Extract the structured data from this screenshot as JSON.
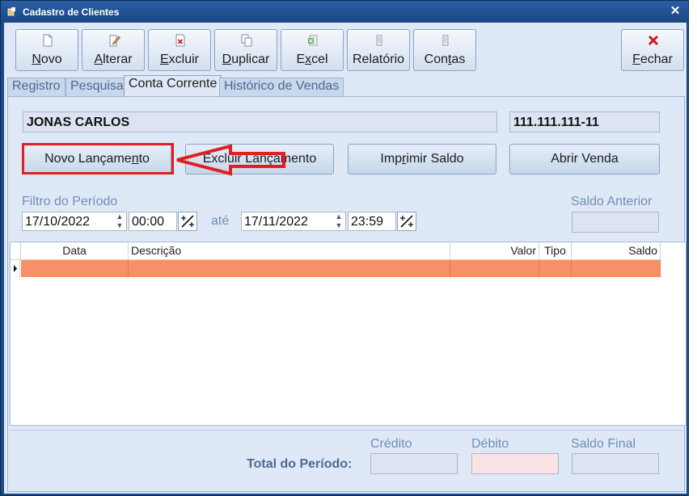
{
  "window": {
    "title": "Cadastro de Clientes",
    "close_symbol": "✕"
  },
  "toolbar": {
    "buttons": [
      {
        "label_pre": "",
        "label_u": "N",
        "label_post": "ovo",
        "icon": "new-document-icon"
      },
      {
        "label_pre": "",
        "label_u": "A",
        "label_post": "lterar",
        "icon": "edit-pencil-icon"
      },
      {
        "label_pre": "",
        "label_u": "E",
        "label_post": "xcluir",
        "icon": "delete-document-icon"
      },
      {
        "label_pre": "",
        "label_u": "D",
        "label_post": "uplicar",
        "icon": "duplicate-icon"
      },
      {
        "label_pre": "E",
        "label_u": "x",
        "label_post": "cel",
        "icon": "excel-icon"
      },
      {
        "label_pre": "Relatório",
        "label_u": "",
        "label_post": "",
        "icon": "report-icon"
      },
      {
        "label_pre": "Con",
        "label_u": "t",
        "label_post": "as",
        "icon": "accounts-icon"
      }
    ],
    "close_button": {
      "label_pre": "",
      "label_u": "F",
      "label_post": "echar",
      "icon": "red-x-icon"
    }
  },
  "tabs": [
    "Registro",
    "Pesquisa",
    "Conta Corrente",
    "Histórico de Vendas"
  ],
  "active_tab": "Conta Corrente",
  "client": {
    "name": "JONAS CARLOS",
    "document": "111.111.111-11"
  },
  "actions": {
    "new_entry": "Novo Lançamento",
    "new_entry_u_index": 12,
    "delete_entry": "Excluir Lançamento",
    "print_balance_pre": "Imp",
    "print_balance_u": "r",
    "print_balance_post": "imir Saldo",
    "open_sale": "Abrir Venda"
  },
  "filter": {
    "label": "Filtro do Período",
    "date_from": "17/10/2022",
    "time_from": "00:00",
    "until_label": "até",
    "date_to": "17/11/2022",
    "time_to": "23:59",
    "previous_balance_label": "Saldo Anterior",
    "previous_balance_value": ""
  },
  "grid": {
    "columns": [
      "Data",
      "Descrição",
      "Valor",
      "Tipo",
      "Saldo"
    ],
    "rows": [
      {
        "data": "",
        "descricao": "",
        "valor": "",
        "tipo": "",
        "saldo": ""
      }
    ],
    "row_highlight_color": "#f59068"
  },
  "totals": {
    "label": "Total do Período:",
    "credit_label": "Crédito",
    "debit_label": "Débito",
    "final_balance_label": "Saldo Final",
    "credit_value": "",
    "debit_value": "",
    "final_balance_value": ""
  },
  "colors": {
    "title_bar": "#1c4785",
    "panel_bg": "#dfe8f6",
    "highlight_red": "#e02020"
  }
}
